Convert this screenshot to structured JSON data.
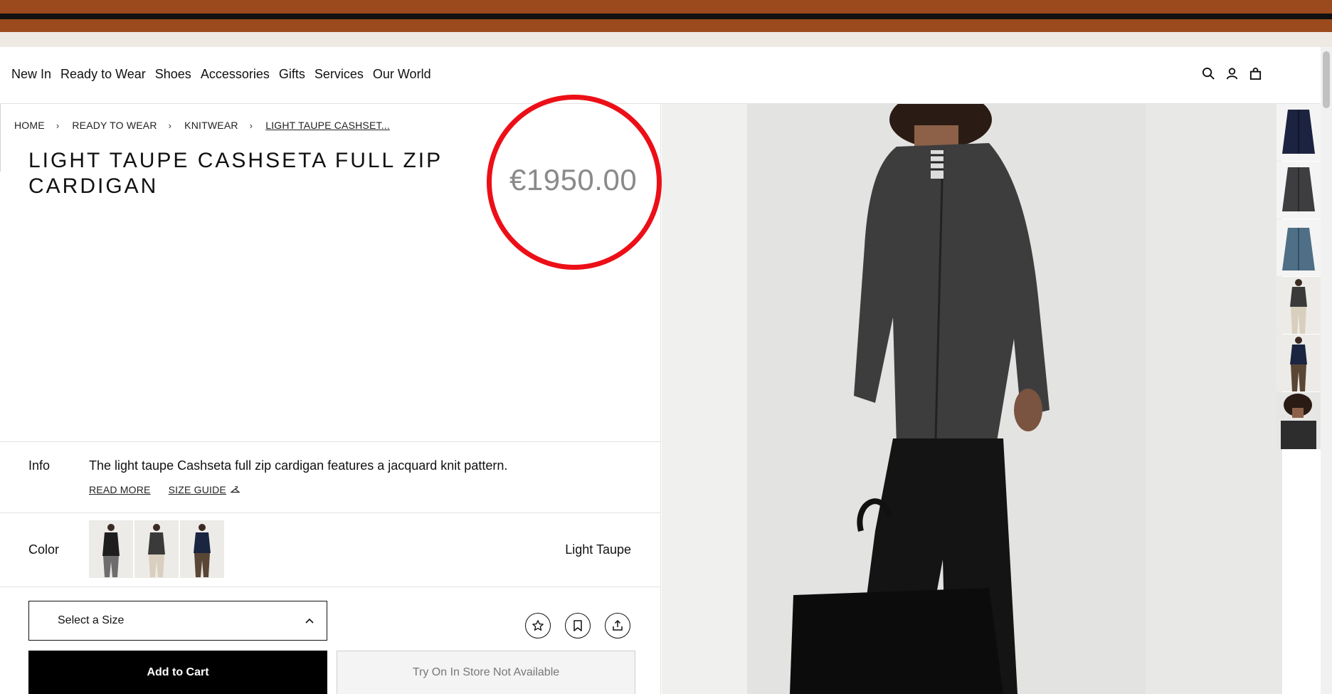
{
  "nav": {
    "items": [
      "New In",
      "Ready to Wear",
      "Shoes",
      "Accessories",
      "Gifts",
      "Services",
      "Our World"
    ],
    "icons": [
      "search-icon",
      "account-icon",
      "bag-icon"
    ]
  },
  "breadcrumb": {
    "items": [
      "HOME",
      "READY TO WEAR",
      "KNITWEAR",
      "LIGHT TAUPE CASHSET..."
    ]
  },
  "product": {
    "title": "LIGHT TAUPE CASHSETA FULL ZIP CARDIGAN",
    "price": "€1950.00"
  },
  "info": {
    "label": "Info",
    "text": "The light taupe Cashseta full zip cardigan features a jacquard knit pattern.",
    "read_more": "READ MORE",
    "size_guide": "SIZE GUIDE"
  },
  "color": {
    "label": "Color",
    "value": "Light Taupe"
  },
  "size": {
    "placeholder": "Select a Size"
  },
  "actions": {
    "add_to_cart": "Add to Cart",
    "try_on": "Try On In Store Not Available"
  },
  "colors": {
    "stripe": "#9a4a1c",
    "annotation": "#ec0f17",
    "price": "#8a8a8a"
  }
}
